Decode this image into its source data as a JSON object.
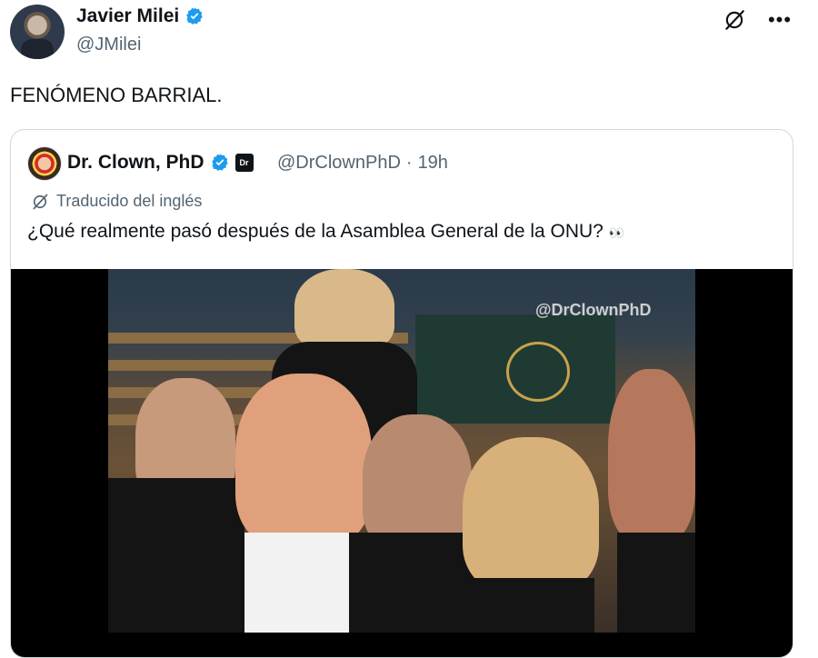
{
  "post": {
    "author_name": "Javier Milei",
    "author_handle": "@JMilei",
    "text": "FENÓMENO BARRIAL."
  },
  "quoted": {
    "author_name": "Dr. Clown, PhD",
    "author_handle": "@DrClownPhD",
    "separator": "·",
    "time": "19h",
    "translated_label": "Traducido del inglés",
    "text": "¿Qué realmente pasó después de la Asamblea General de la ONU?",
    "emoji": "👀",
    "affiliate_badge": "Dr",
    "media_watermark": "@DrClownPhD"
  },
  "icons": {
    "verified": "verified-badge-icon",
    "grok": "grok-icon",
    "more": "more-icon",
    "translate": "translate-icon"
  },
  "colors": {
    "verified_blue": "#1d9bf0",
    "secondary_text": "#536471",
    "border": "#cfd9de"
  }
}
